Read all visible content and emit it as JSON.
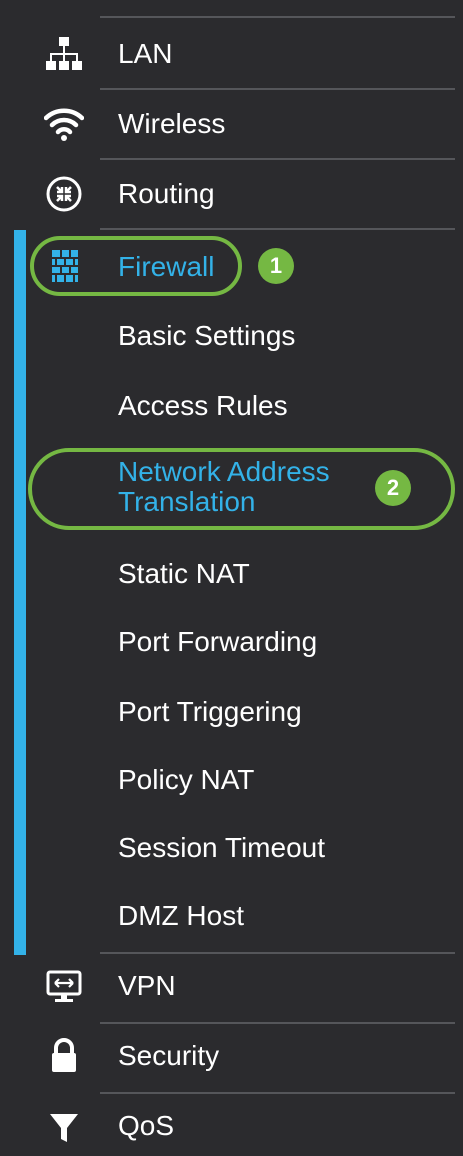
{
  "nav": {
    "top_items": [
      {
        "label": "LAN",
        "icon": "network-hierarchy-icon"
      },
      {
        "label": "Wireless",
        "icon": "wifi-icon"
      },
      {
        "label": "Routing",
        "icon": "routing-arrows-icon"
      }
    ],
    "firewall": {
      "label": "Firewall",
      "icon": "firewall-brick-icon",
      "badge": "1",
      "subitems": [
        {
          "label": "Basic Settings"
        },
        {
          "label": "Access Rules"
        },
        {
          "label": "Network Address",
          "label2": "Translation",
          "badge": "2"
        },
        {
          "label": "Static NAT"
        },
        {
          "label": "Port Forwarding"
        },
        {
          "label": "Port Triggering"
        },
        {
          "label": "Policy NAT"
        },
        {
          "label": "Session Timeout"
        },
        {
          "label": "DMZ Host"
        }
      ]
    },
    "bottom_items": [
      {
        "label": "VPN",
        "icon": "vpn-monitor-icon"
      },
      {
        "label": "Security",
        "icon": "lock-icon"
      },
      {
        "label": "QoS",
        "icon": "filter-funnel-icon"
      }
    ],
    "colors": {
      "background": "#2b2b2e",
      "accent": "#33b2e8",
      "highlight": "#75b843",
      "text": "#ffffff"
    }
  }
}
